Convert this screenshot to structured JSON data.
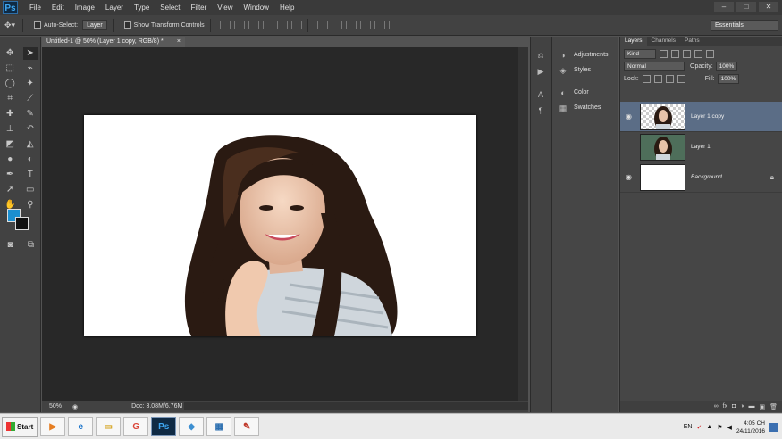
{
  "app": {
    "logo": "Ps"
  },
  "menu": [
    "File",
    "Edit",
    "Image",
    "Layer",
    "Type",
    "Select",
    "Filter",
    "View",
    "Window",
    "Help"
  ],
  "window_controls": [
    "–",
    "□",
    "✕"
  ],
  "options_bar": {
    "auto_select_label": "Auto-Select:",
    "auto_select_value": "Layer",
    "show_transform_label": "Show Transform Controls",
    "workspace": "Essentials"
  },
  "document": {
    "tab_title": "Untitled-1 @ 50% (Layer 1 copy, RGB/8) *",
    "tab_close": "×",
    "zoom": "50%",
    "doc_info": "Doc: 3.08M/6.76M"
  },
  "colors": {
    "foreground": "#1b8fd0",
    "background": "#111111",
    "selection": "#5b6d86"
  },
  "panel_group": {
    "items": [
      {
        "label": "Adjustments",
        "icon": "adjustments-icon"
      },
      {
        "label": "Styles",
        "icon": "styles-icon"
      },
      {
        "label": "Color",
        "icon": "color-icon"
      },
      {
        "label": "Swatches",
        "icon": "swatches-icon"
      }
    ]
  },
  "layers_panel": {
    "tabs": [
      "Layers",
      "Channels",
      "Paths"
    ],
    "kind_filter": "Kind",
    "blend_mode": "Normal",
    "opacity_label": "Opacity:",
    "opacity": "100%",
    "lock_label": "Lock:",
    "fill_label": "Fill:",
    "fill": "100%",
    "layers": [
      {
        "name": "Layer 1 copy",
        "visible": true,
        "selected": true
      },
      {
        "name": "Layer 1",
        "visible": false,
        "selected": false
      },
      {
        "name": "Background",
        "visible": true,
        "selected": false,
        "locked": true
      }
    ]
  },
  "taskbar": {
    "start_label": "Start",
    "apps": [
      {
        "name": "media-player",
        "glyph": "▶"
      },
      {
        "name": "internet-explorer",
        "glyph": "e"
      },
      {
        "name": "file-explorer",
        "glyph": "▭"
      },
      {
        "name": "chrome",
        "glyph": "G"
      },
      {
        "name": "photoshop",
        "glyph": "Ps"
      },
      {
        "name": "app-6",
        "glyph": "◆"
      },
      {
        "name": "app-7",
        "glyph": "▦"
      },
      {
        "name": "paint",
        "glyph": "✎"
      }
    ],
    "language": "EN",
    "time": "4:05 CH",
    "date": "24/11/2016"
  }
}
